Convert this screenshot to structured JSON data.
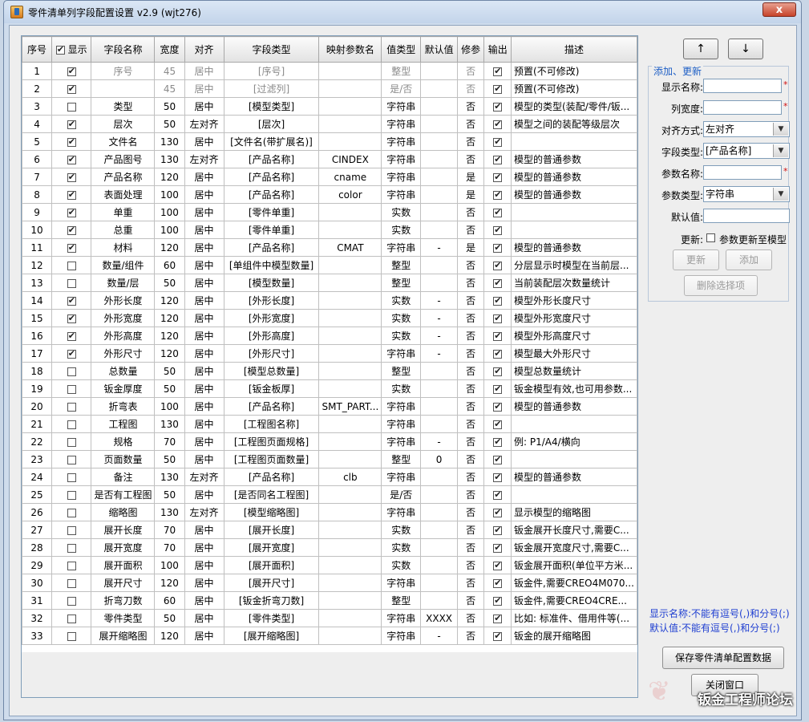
{
  "window": {
    "title": "零件清单列字段配置设置 v2.9 (wjt276)",
    "close_glyph": "x"
  },
  "table": {
    "headers": [
      "序号",
      "显示",
      "字段名称",
      "宽度",
      "对齐",
      "字段类型",
      "映射参数名",
      "值类型",
      "默认值",
      "修参",
      "输出",
      "描述"
    ],
    "header_show_checked": true,
    "rows": [
      {
        "no": "1",
        "show": true,
        "name": "序号",
        "width": "45",
        "align": "居中",
        "ftype": "[序号]",
        "param": "",
        "vtype": "整型",
        "def": "",
        "mod": "否",
        "out": true,
        "desc": "预置(不可修改)",
        "gray": true
      },
      {
        "no": "2",
        "show": true,
        "name": "",
        "width": "45",
        "align": "居中",
        "ftype": "[过滤列]",
        "param": "",
        "vtype": "是/否",
        "def": "",
        "mod": "否",
        "out": true,
        "desc": "预置(不可修改)",
        "gray": true
      },
      {
        "no": "3",
        "show": false,
        "name": "类型",
        "width": "50",
        "align": "居中",
        "ftype": "[模型类型]",
        "param": "",
        "vtype": "字符串",
        "def": "",
        "mod": "否",
        "out": true,
        "desc": "模型的类型(装配/零件/钣..."
      },
      {
        "no": "4",
        "show": true,
        "name": "层次",
        "width": "50",
        "align": "左对齐",
        "ftype": "[层次]",
        "param": "",
        "vtype": "字符串",
        "def": "",
        "mod": "否",
        "out": true,
        "desc": "模型之间的装配等级层次"
      },
      {
        "no": "5",
        "show": true,
        "name": "文件名",
        "width": "130",
        "align": "居中",
        "ftype": "[文件名(带扩展名)]",
        "param": "",
        "vtype": "字符串",
        "def": "",
        "mod": "否",
        "out": true,
        "desc": ""
      },
      {
        "no": "6",
        "show": true,
        "name": "产品图号",
        "width": "130",
        "align": "左对齐",
        "ftype": "[产品名称]",
        "param": "CINDEX",
        "vtype": "字符串",
        "def": "",
        "mod": "否",
        "out": true,
        "desc": "模型的普通参数"
      },
      {
        "no": "7",
        "show": true,
        "name": "产品名称",
        "width": "120",
        "align": "居中",
        "ftype": "[产品名称]",
        "param": "cname",
        "vtype": "字符串",
        "def": "",
        "mod": "是",
        "out": true,
        "desc": "模型的普通参数"
      },
      {
        "no": "8",
        "show": true,
        "name": "表面处理",
        "width": "100",
        "align": "居中",
        "ftype": "[产品名称]",
        "param": "color",
        "vtype": "字符串",
        "def": "",
        "mod": "是",
        "out": true,
        "desc": "模型的普通参数"
      },
      {
        "no": "9",
        "show": true,
        "name": "单重",
        "width": "100",
        "align": "居中",
        "ftype": "[零件单重]",
        "param": "",
        "vtype": "实数",
        "def": "",
        "mod": "否",
        "out": true,
        "desc": ""
      },
      {
        "no": "10",
        "show": true,
        "name": "总重",
        "width": "100",
        "align": "居中",
        "ftype": "[零件单重]",
        "param": "",
        "vtype": "实数",
        "def": "",
        "mod": "否",
        "out": true,
        "desc": ""
      },
      {
        "no": "11",
        "show": true,
        "name": "材料",
        "width": "120",
        "align": "居中",
        "ftype": "[产品名称]",
        "param": "CMAT",
        "vtype": "字符串",
        "def": "-",
        "mod": "是",
        "out": true,
        "desc": "模型的普通参数"
      },
      {
        "no": "12",
        "show": false,
        "name": "数量/组件",
        "width": "60",
        "align": "居中",
        "ftype": "[单组件中模型数量]",
        "param": "",
        "vtype": "整型",
        "def": "",
        "mod": "否",
        "out": true,
        "desc": "分层显示时模型在当前层..."
      },
      {
        "no": "13",
        "show": false,
        "name": "数量/层",
        "width": "50",
        "align": "居中",
        "ftype": "[模型数量]",
        "param": "",
        "vtype": "整型",
        "def": "",
        "mod": "否",
        "out": true,
        "desc": "当前装配层次数量统计"
      },
      {
        "no": "14",
        "show": true,
        "name": "外形长度",
        "width": "120",
        "align": "居中",
        "ftype": "[外形长度]",
        "param": "",
        "vtype": "实数",
        "def": "-",
        "mod": "否",
        "out": true,
        "desc": "模型外形长度尺寸"
      },
      {
        "no": "15",
        "show": true,
        "name": "外形宽度",
        "width": "120",
        "align": "居中",
        "ftype": "[外形宽度]",
        "param": "",
        "vtype": "实数",
        "def": "-",
        "mod": "否",
        "out": true,
        "desc": "模型外形宽度尺寸"
      },
      {
        "no": "16",
        "show": true,
        "name": "外形高度",
        "width": "120",
        "align": "居中",
        "ftype": "[外形高度]",
        "param": "",
        "vtype": "实数",
        "def": "-",
        "mod": "否",
        "out": true,
        "desc": "模型外形高度尺寸"
      },
      {
        "no": "17",
        "show": true,
        "name": "外形尺寸",
        "width": "120",
        "align": "居中",
        "ftype": "[外形尺寸]",
        "param": "",
        "vtype": "字符串",
        "def": "-",
        "mod": "否",
        "out": true,
        "desc": "模型最大外形尺寸"
      },
      {
        "no": "18",
        "show": false,
        "name": "总数量",
        "width": "50",
        "align": "居中",
        "ftype": "[模型总数量]",
        "param": "",
        "vtype": "整型",
        "def": "",
        "mod": "否",
        "out": true,
        "desc": "模型总数量统计"
      },
      {
        "no": "19",
        "show": false,
        "name": "钣金厚度",
        "width": "50",
        "align": "居中",
        "ftype": "[钣金板厚]",
        "param": "",
        "vtype": "实数",
        "def": "",
        "mod": "否",
        "out": true,
        "desc": "钣金模型有效,也可用参数..."
      },
      {
        "no": "20",
        "show": false,
        "name": "折弯表",
        "width": "100",
        "align": "居中",
        "ftype": "[产品名称]",
        "param": "SMT_PART...",
        "vtype": "字符串",
        "def": "",
        "mod": "否",
        "out": true,
        "desc": "模型的普通参数"
      },
      {
        "no": "21",
        "show": false,
        "name": "工程图",
        "width": "130",
        "align": "居中",
        "ftype": "[工程图名称]",
        "param": "",
        "vtype": "字符串",
        "def": "",
        "mod": "否",
        "out": true,
        "desc": ""
      },
      {
        "no": "22",
        "show": false,
        "name": "规格",
        "width": "70",
        "align": "居中",
        "ftype": "[工程图页面规格]",
        "param": "",
        "vtype": "字符串",
        "def": "-",
        "mod": "否",
        "out": true,
        "desc": "例: P1/A4/横向"
      },
      {
        "no": "23",
        "show": false,
        "name": "页面数量",
        "width": "50",
        "align": "居中",
        "ftype": "[工程图页面数量]",
        "param": "",
        "vtype": "整型",
        "def": "0",
        "mod": "否",
        "out": true,
        "desc": ""
      },
      {
        "no": "24",
        "show": false,
        "name": "备注",
        "width": "130",
        "align": "左对齐",
        "ftype": "[产品名称]",
        "param": "clb",
        "vtype": "字符串",
        "def": "",
        "mod": "否",
        "out": true,
        "desc": "模型的普通参数"
      },
      {
        "no": "25",
        "show": false,
        "name": "是否有工程图",
        "width": "50",
        "align": "居中",
        "ftype": "[是否同名工程图]",
        "param": "",
        "vtype": "是/否",
        "def": "",
        "mod": "否",
        "out": true,
        "desc": ""
      },
      {
        "no": "26",
        "show": false,
        "name": "缩略图",
        "width": "130",
        "align": "左对齐",
        "ftype": "[模型缩略图]",
        "param": "",
        "vtype": "字符串",
        "def": "",
        "mod": "否",
        "out": true,
        "desc": "显示模型的缩略图"
      },
      {
        "no": "27",
        "show": false,
        "name": "展开长度",
        "width": "70",
        "align": "居中",
        "ftype": "[展开长度]",
        "param": "",
        "vtype": "实数",
        "def": "",
        "mod": "否",
        "out": true,
        "desc": "钣金展开长度尺寸,需要C..."
      },
      {
        "no": "28",
        "show": false,
        "name": "展开宽度",
        "width": "70",
        "align": "居中",
        "ftype": "[展开宽度]",
        "param": "",
        "vtype": "实数",
        "def": "",
        "mod": "否",
        "out": true,
        "desc": "钣金展开宽度尺寸,需要C..."
      },
      {
        "no": "29",
        "show": false,
        "name": "展开面积",
        "width": "100",
        "align": "居中",
        "ftype": "[展开面积]",
        "param": "",
        "vtype": "实数",
        "def": "",
        "mod": "否",
        "out": true,
        "desc": "钣金展开面积(单位平方米..."
      },
      {
        "no": "30",
        "show": false,
        "name": "展开尺寸",
        "width": "120",
        "align": "居中",
        "ftype": "[展开尺寸]",
        "param": "",
        "vtype": "字符串",
        "def": "",
        "mod": "否",
        "out": true,
        "desc": "钣金件,需要CREO4M070..."
      },
      {
        "no": "31",
        "show": false,
        "name": "折弯刀数",
        "width": "60",
        "align": "居中",
        "ftype": "[钣金折弯刀数]",
        "param": "",
        "vtype": "整型",
        "def": "",
        "mod": "否",
        "out": true,
        "desc": "钣金件,需要CREO4CRE..."
      },
      {
        "no": "32",
        "show": false,
        "name": "零件类型",
        "width": "50",
        "align": "居中",
        "ftype": "[零件类型]",
        "param": "",
        "vtype": "字符串",
        "def": "XXXX",
        "mod": "否",
        "out": true,
        "desc": "比如: 标准件、借用件等(..."
      },
      {
        "no": "33",
        "show": false,
        "name": "展开缩略图",
        "width": "120",
        "align": "居中",
        "ftype": "[展开缩略图]",
        "param": "",
        "vtype": "字符串",
        "def": "-",
        "mod": "否",
        "out": true,
        "desc": "钣金的展开缩略图"
      }
    ]
  },
  "side": {
    "up_label": "↑",
    "down_label": "↓",
    "group_title": "添加、更新",
    "fields": {
      "display_name_label": "显示名称:",
      "col_width_label": "列宽度:",
      "align_label": "对齐方式:",
      "align_value": "左对齐",
      "field_type_label": "字段类型:",
      "field_type_value": "[产品名称]",
      "param_name_label": "参数名称:",
      "param_type_label": "参数类型:",
      "param_type_value": "字符串",
      "default_label": "默认值:",
      "update_label": "更新:",
      "update_check_label": "参数更新至模型",
      "required_mark": "*"
    },
    "update_button": "更新",
    "add_button": "添加",
    "delete_button": "删除选择项",
    "note1": "显示名称:不能有逗号(,)和分号(;)",
    "note2": "默认值:不能有逗号(,)和分号(;)",
    "save_button": "保存零件清单配置数据",
    "close_button": "关闭窗口"
  },
  "watermark": "钣金工程师论坛"
}
